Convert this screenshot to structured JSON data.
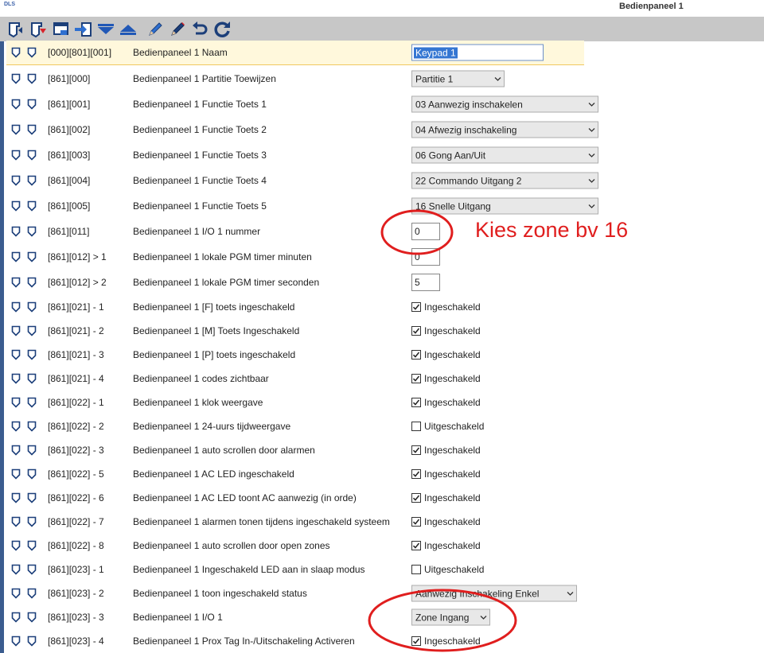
{
  "window": {
    "logo": "DLS",
    "title": "Bedienpaneel 1"
  },
  "toolbar": {
    "icons": [
      "upload-icon",
      "download-icon",
      "window-icon",
      "transfer-icon",
      "arrow-down-icon",
      "arrow-up-icon",
      "pen-icon",
      "pen-icon",
      "undo-icon",
      "refresh-icon"
    ]
  },
  "annotation": {
    "text": "Kies zone bv 16",
    "color": "#e01e1e"
  },
  "rows": [
    {
      "code": "[000][801][001]",
      "label": "Bedienpaneel 1 Naam",
      "kind": "text",
      "value": "Keypad 1"
    },
    {
      "code": "[861][000]",
      "label": "Bedienpaneel 1 Partitie Toewijzen",
      "kind": "select",
      "value": "Partitie 1"
    },
    {
      "code": "[861][001]",
      "label": "Bedienpaneel 1 Functie Toets 1",
      "kind": "select",
      "value": "03 Aanwezig inschakelen"
    },
    {
      "code": "[861][002]",
      "label": "Bedienpaneel 1 Functie Toets 2",
      "kind": "select",
      "value": "04 Afwezig inschakeling"
    },
    {
      "code": "[861][003]",
      "label": "Bedienpaneel 1 Functie Toets 3",
      "kind": "select",
      "value": "06 Gong Aan/Uit"
    },
    {
      "code": "[861][004]",
      "label": "Bedienpaneel 1 Functie Toets 4",
      "kind": "select",
      "value": "22 Commando Uitgang 2"
    },
    {
      "code": "[861][005]",
      "label": "Bedienpaneel 1 Functie Toets 5",
      "kind": "select",
      "value": "16 Snelle Uitgang"
    },
    {
      "code": "[861][011]",
      "label": "Bedienpaneel 1 I/O 1 nummer",
      "kind": "number",
      "value": "0"
    },
    {
      "code": "[861][012] > 1",
      "label": "Bedienpaneel 1 lokale PGM timer minuten",
      "kind": "number",
      "value": "0"
    },
    {
      "code": "[861][012] > 2",
      "label": "Bedienpaneel 1 lokale PGM timer seconden",
      "kind": "number",
      "value": "5"
    },
    {
      "code": "[861][021] - 1",
      "label": "Bedienpaneel 1 [F] toets ingeschakeld",
      "kind": "check",
      "checked": true,
      "value": "Ingeschakeld"
    },
    {
      "code": "[861][021] - 2",
      "label": "Bedienpaneel 1 [M] Toets Ingeschakeld",
      "kind": "check",
      "checked": true,
      "value": "Ingeschakeld"
    },
    {
      "code": "[861][021] - 3",
      "label": "Bedienpaneel 1 [P] toets ingeschakeld",
      "kind": "check",
      "checked": true,
      "value": "Ingeschakeld"
    },
    {
      "code": "[861][021] - 4",
      "label": "Bedienpaneel 1 codes zichtbaar",
      "kind": "check",
      "checked": true,
      "value": "Ingeschakeld"
    },
    {
      "code": "[861][022] - 1",
      "label": "Bedienpaneel 1 klok weergave",
      "kind": "check",
      "checked": true,
      "value": "Ingeschakeld"
    },
    {
      "code": "[861][022] - 2",
      "label": "Bedienpaneel 1 24-uurs tijdweergave",
      "kind": "check",
      "checked": false,
      "value": "Uitgeschakeld"
    },
    {
      "code": "[861][022] - 3",
      "label": "Bedienpaneel 1 auto scrollen door alarmen",
      "kind": "check",
      "checked": true,
      "value": "Ingeschakeld"
    },
    {
      "code": "[861][022] - 5",
      "label": "Bedienpaneel 1 AC LED ingeschakeld",
      "kind": "check",
      "checked": true,
      "value": "Ingeschakeld"
    },
    {
      "code": "[861][022] - 6",
      "label": "Bedienpaneel 1 AC LED toont AC aanwezig (in orde)",
      "kind": "check",
      "checked": true,
      "value": "Ingeschakeld"
    },
    {
      "code": "[861][022] - 7",
      "label": "Bedienpaneel 1 alarmen tonen tijdens ingeschakeld systeem",
      "kind": "check",
      "checked": true,
      "value": "Ingeschakeld"
    },
    {
      "code": "[861][022] - 8",
      "label": "Bedienpaneel 1 auto scrollen door open zones",
      "kind": "check",
      "checked": true,
      "value": "Ingeschakeld"
    },
    {
      "code": "[861][023] - 1",
      "label": "Bedienpaneel 1 Ingeschakeld LED aan in slaap modus",
      "kind": "check",
      "checked": false,
      "value": "Uitgeschakeld"
    },
    {
      "code": "[861][023] - 2",
      "label": "Bedienpaneel 1 toon ingeschakeld status",
      "kind": "select",
      "value": "Aanwezig Inschakeling Enkel"
    },
    {
      "code": "[861][023] - 3",
      "label": "Bedienpaneel 1 I/O 1",
      "kind": "select",
      "value": "Zone Ingang"
    },
    {
      "code": "[861][023] - 4",
      "label": "Bedienpaneel 1 Prox Tag In-/Uitschakeling Activeren",
      "kind": "check",
      "checked": true,
      "value": "Ingeschakeld"
    }
  ]
}
